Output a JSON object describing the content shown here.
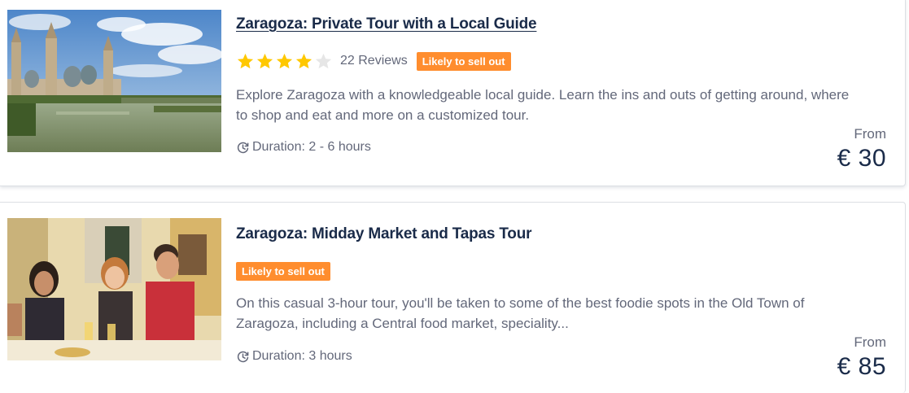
{
  "colors": {
    "title": "#1a2b49",
    "body_text": "#63687a",
    "badge_bg": "#ff8d2e",
    "star_filled": "#ffc800",
    "star_empty": "#e6e6e6"
  },
  "tours": [
    {
      "title": "Zaragoza: Private Tour with a Local Guide",
      "image_icon": "zaragoza-basilica-photo",
      "rating": 4,
      "max_rating": 5,
      "reviews_label": "22 Reviews",
      "badge": "Likely to sell out",
      "description": "Explore Zaragoza with a knowledgeable local guide. Learn the ins and outs of getting around, where to shop and eat and more on a customized tour.",
      "duration_icon": "clock-icon",
      "duration": "Duration: 2 - 6 hours",
      "price_from": "From",
      "price": "€ 30"
    },
    {
      "title": "Zaragoza: Midday Market and Tapas Tour",
      "image_icon": "tapas-friends-photo",
      "badge": "Likely to sell out",
      "description": "On this casual 3-hour tour, you'll be taken to some of the best foodie spots in the Old Town of Zaragoza, including a Central food market, speciality...",
      "duration_icon": "clock-icon",
      "duration": "Duration: 3 hours",
      "price_from": "From",
      "price": "€ 85"
    }
  ]
}
